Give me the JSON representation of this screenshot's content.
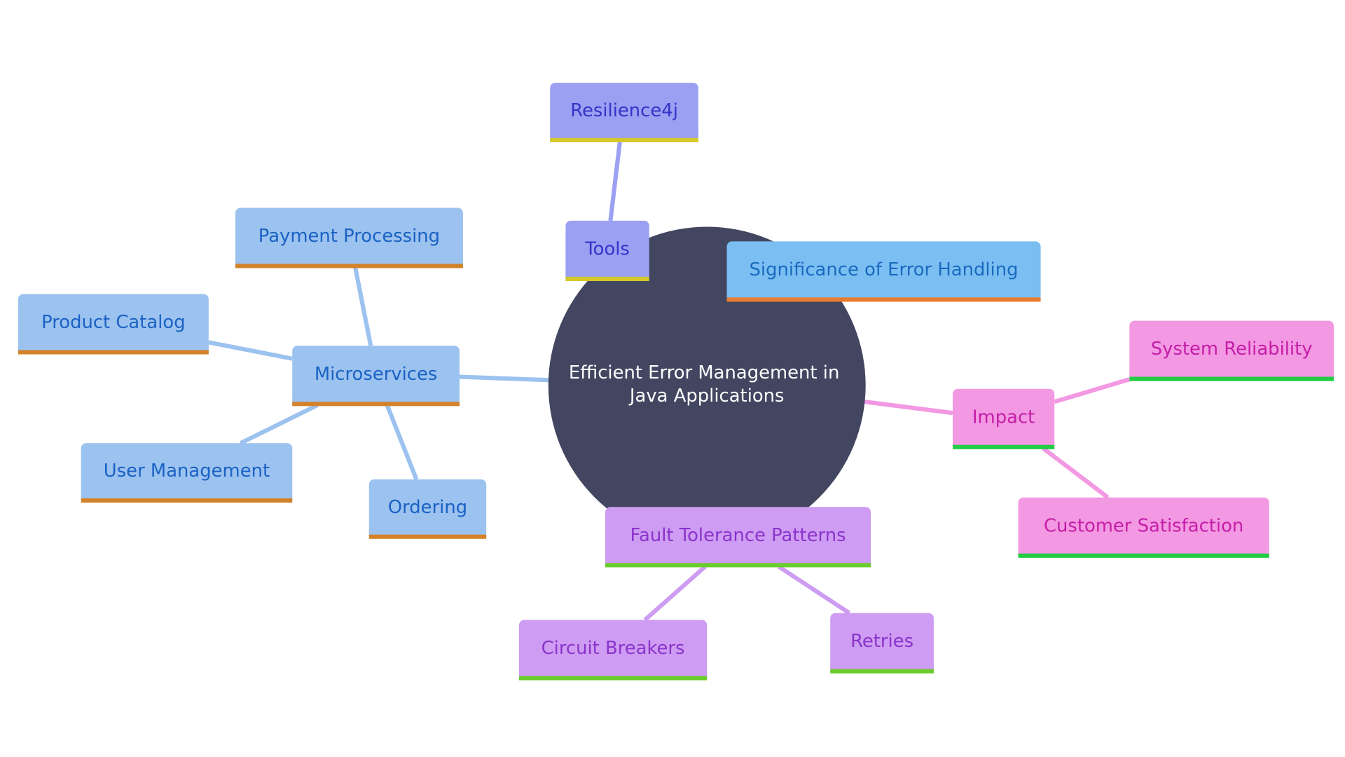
{
  "mindmap": {
    "root": {
      "id": "root",
      "label_lines": [
        "Efficient Error Management in",
        "Java Applications"
      ],
      "fill": "#424660",
      "text_color": "#ffffff"
    },
    "nodes": [
      {
        "id": "resilience4j",
        "label": "Resilience4j",
        "parent": "tools",
        "fill": "#9CA0F2",
        "text": "#3434C8",
        "underline": "#D4C82A",
        "edge": "#9CA0F2"
      },
      {
        "id": "tools",
        "label": "Tools",
        "parent": "root",
        "fill": "#9CA0F2",
        "text": "#3434C8",
        "underline": "#D4C82A",
        "edge": "#9CA0F2"
      },
      {
        "id": "significance",
        "label": "Significance of Error Handling",
        "parent": "root",
        "fill": "#7BBFF2",
        "text": "#1A6AC0",
        "underline": "#E87C2E",
        "edge": "#7BBFF2"
      },
      {
        "id": "payment",
        "label": "Payment Processing",
        "parent": "microservices",
        "fill": "#9CC2EF",
        "text": "#1A62C4",
        "underline": "#D4822A",
        "edge": "#9CC2EF"
      },
      {
        "id": "catalog",
        "label": "Product Catalog",
        "parent": "microservices",
        "fill": "#9CC2EF",
        "text": "#1A62C4",
        "underline": "#D4822A",
        "edge": "#9CC2EF"
      },
      {
        "id": "microservices",
        "label": "Microservices",
        "parent": "root",
        "fill": "#9CC2EF",
        "text": "#1A62C4",
        "underline": "#D4822A",
        "edge": "#9CC2EF"
      },
      {
        "id": "users",
        "label": "User Management",
        "parent": "microservices",
        "fill": "#9CC2EF",
        "text": "#1A62C4",
        "underline": "#D4822A",
        "edge": "#9CC2EF"
      },
      {
        "id": "ordering",
        "label": "Ordering",
        "parent": "microservices",
        "fill": "#9CC2EF",
        "text": "#1A62C4",
        "underline": "#D4822A",
        "edge": "#9CC2EF"
      },
      {
        "id": "impact",
        "label": "Impact",
        "parent": "root",
        "fill": "#F398E2",
        "text": "#C41EA8",
        "underline": "#22CC44",
        "edge": "#F398E2"
      },
      {
        "id": "reliability",
        "label": "System Reliability",
        "parent": "impact",
        "fill": "#F398E2",
        "text": "#C41EA8",
        "underline": "#22CC44",
        "edge": "#F398E2"
      },
      {
        "id": "satisfaction",
        "label": "Customer Satisfaction",
        "parent": "impact",
        "fill": "#F398E2",
        "text": "#C41EA8",
        "underline": "#22CC44",
        "edge": "#F398E2"
      },
      {
        "id": "fault",
        "label": "Fault Tolerance Patterns",
        "parent": "root",
        "fill": "#CE9CF2",
        "text": "#8A34CC",
        "underline": "#6CCC2E",
        "edge": "#CE9CF2"
      },
      {
        "id": "circuit",
        "label": "Circuit Breakers",
        "parent": "fault",
        "fill": "#CE9CF2",
        "text": "#8A34CC",
        "underline": "#6CCC2E",
        "edge": "#CE9CF2"
      },
      {
        "id": "retries",
        "label": "Retries",
        "parent": "fault",
        "fill": "#CE9CF2",
        "text": "#8A34CC",
        "underline": "#6CCC2E",
        "edge": "#CE9CF2"
      }
    ]
  }
}
